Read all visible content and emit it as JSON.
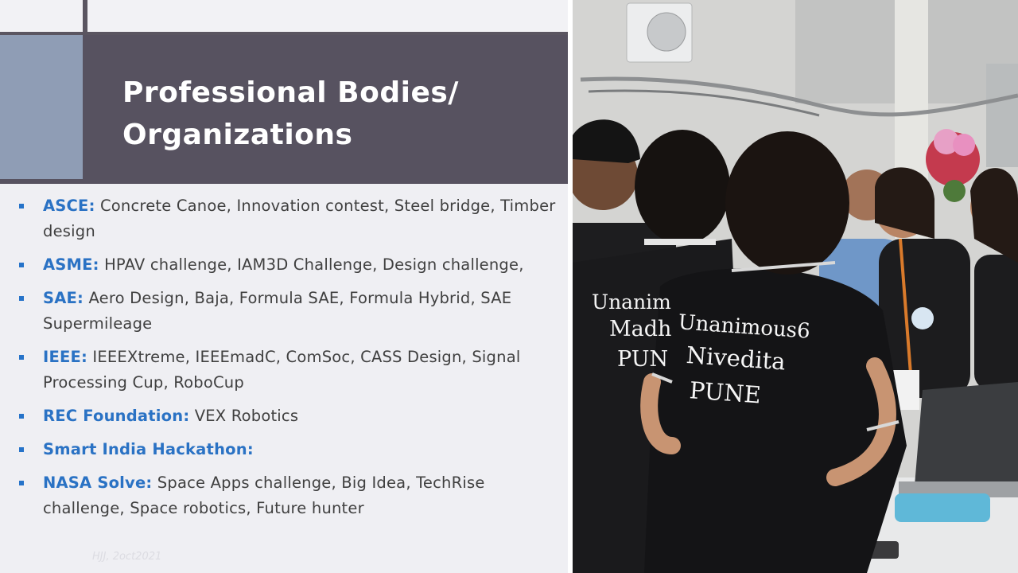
{
  "slide": {
    "title_line1": "Professional Bodies/",
    "title_line2": "Organizations",
    "items": [
      {
        "org": "ASCE:",
        "text": " Concrete Canoe, Innovation contest, Steel bridge, Timber design"
      },
      {
        "org": "ASME:",
        "text": " HPAV challenge, IAM3D Challenge, Design challenge,"
      },
      {
        "org": "SAE:",
        "text": " Aero Design, Baja, Formula SAE, Formula Hybrid, SAE Supermileage"
      },
      {
        "org": "IEEE:",
        "text": " IEEEXtreme, IEEEmadC, ComSoc, CASS Design, Signal Processing Cup, RoboCup"
      },
      {
        "org": "REC Foundation:",
        "text": " VEX Robotics"
      },
      {
        "org": "Smart India Hackathon:",
        "text": ""
      },
      {
        "org": "NASA Solve:",
        "text": " Space Apps challenge, Big Idea, TechRise challenge, Space robotics, Future hunter"
      }
    ],
    "watermark": "HJJ, 2oct2021"
  },
  "photo": {
    "shirt_left_line1": "Unanim",
    "shirt_left_line2": "Madh",
    "shirt_left_line3": "PUN",
    "shirt_right_line1": "Unanimous6",
    "shirt_right_line2": "Nivedita",
    "shirt_right_line3": "PUNE"
  },
  "colors": {
    "title_bg": "#575260",
    "accent": "#8f9db5",
    "org_text": "#2a72c4",
    "body_text": "#404040",
    "panel_bg": "#efeff3"
  }
}
